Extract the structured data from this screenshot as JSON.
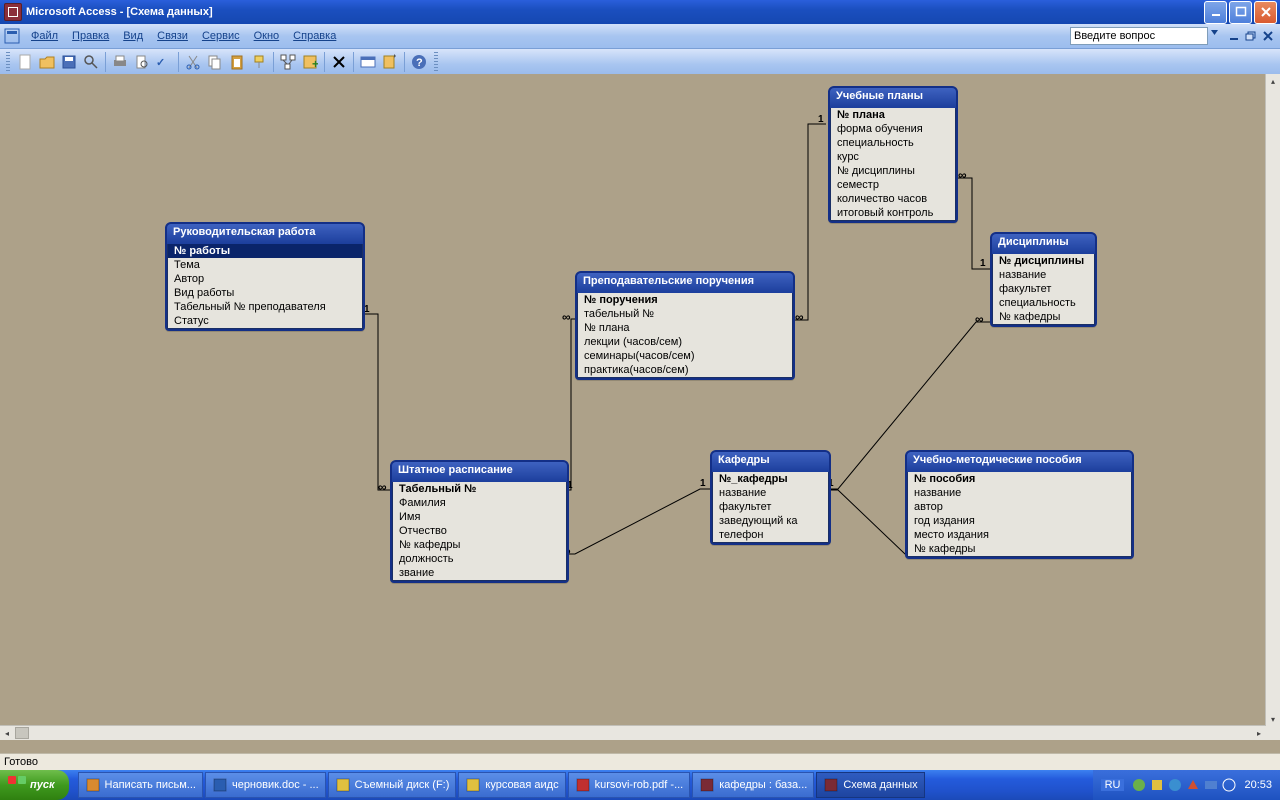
{
  "title_bar": {
    "text": "Microsoft Access - [Схема данных]"
  },
  "menu": [
    "Файл",
    "Правка",
    "Вид",
    "Связи",
    "Сервис",
    "Окно",
    "Справка"
  ],
  "help_placeholder": "Введите вопрос",
  "status": "Готово",
  "entities": {
    "supervisory": {
      "title": "Руководительская работа",
      "fields": [
        "№ работы",
        "Тема",
        "Автор",
        "Вид работы",
        "Табельный № преподавателя",
        "Статус"
      ],
      "pk": 0,
      "selected": 0
    },
    "schedule": {
      "title": "Штатное расписание",
      "fields": [
        "Табельный №",
        "Фамилия",
        "Имя",
        "Отчество",
        "№ кафедры",
        "должность",
        "звание"
      ],
      "pk": 0
    },
    "assignments": {
      "title": "Преподавательские поручения",
      "fields": [
        "№ поручения",
        "табельный №",
        "№ плана",
        "лекции (часов/сем)",
        "семинары(часов/сем)",
        "практика(часов/сем)"
      ],
      "pk": 0
    },
    "departments": {
      "title": "Кафедры",
      "fields": [
        "№_кафедры",
        "название",
        "факультет",
        "заведующий кафедрой",
        "телефон"
      ],
      "pk": 0
    },
    "plans": {
      "title": "Учебные планы",
      "fields": [
        "№ плана",
        "форма обучения",
        "специальность",
        "курс",
        "№ дисциплины",
        "семестр",
        "количество часов",
        "итоговый контроль"
      ],
      "pk": 0
    },
    "disciplines": {
      "title": "Дисциплины",
      "fields": [
        "№ дисциплины",
        "название",
        "факультет",
        "специальность",
        "№ кафедры"
      ],
      "pk": 0
    },
    "materials": {
      "title": "Учебно-методические пособия",
      "fields": [
        "№ пособия",
        "название",
        "автор",
        "год издания",
        "место издания",
        "№  кафедры"
      ],
      "pk": 0
    }
  },
  "taskbar": {
    "start": "пуск",
    "items": [
      {
        "label": "Написать письм...",
        "color": "#D88A30"
      },
      {
        "label": "черновик.doc - ...",
        "color": "#2A5DB0"
      },
      {
        "label": "Съемный диск (F:)",
        "color": "#E0C040"
      },
      {
        "label": "курсовая аидс",
        "color": "#E0C040"
      },
      {
        "label": "kursovi-rob.pdf -...",
        "color": "#C03030"
      },
      {
        "label": "кафедры : база...",
        "color": "#7A2A35",
        "active": false
      },
      {
        "label": "Схема данных",
        "color": "#7A2A35",
        "active": true
      }
    ],
    "lang": "RU",
    "clock": "20:53"
  }
}
